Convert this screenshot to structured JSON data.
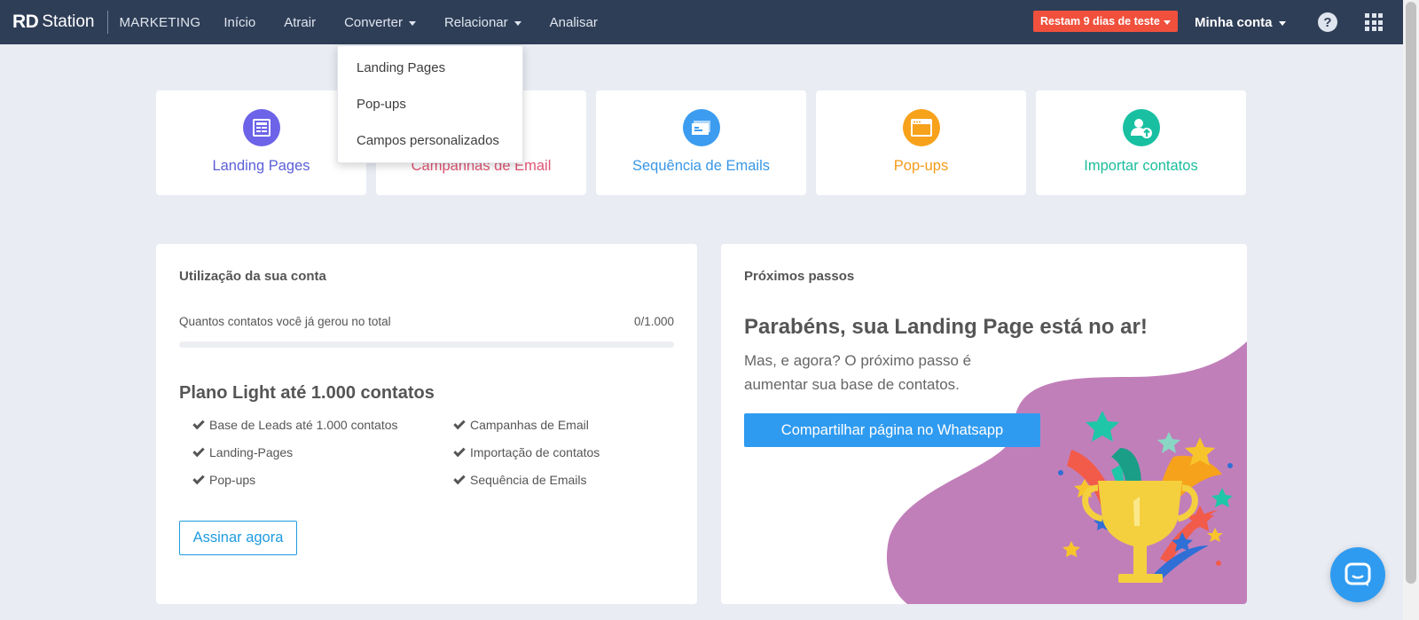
{
  "brand": {
    "logo_bold": "RD",
    "logo_rest": "Station",
    "product": "MARKETING"
  },
  "nav": {
    "items": [
      {
        "label": "Início"
      },
      {
        "label": "Atrair"
      },
      {
        "label": "Converter",
        "has_caret": true
      },
      {
        "label": "Relacionar",
        "has_caret": true
      },
      {
        "label": "Analisar"
      }
    ]
  },
  "header": {
    "trial_label": "Restam 9 dias de teste",
    "account_label": "Minha conta",
    "help_glyph": "?",
    "help_icon": "question-circle-icon",
    "apps_icon": "grid-apps-icon"
  },
  "dropdown": {
    "items": [
      "Landing Pages",
      "Pop-ups",
      "Campos personalizados"
    ]
  },
  "shortcuts": [
    {
      "label": "Landing Pages",
      "color": "#6c63e8",
      "text_color": "#5b5fd6",
      "icon": "landing-page-icon"
    },
    {
      "label": "Campanhas de Email",
      "color": "#e84a6f",
      "text_color": "#e05574",
      "icon": "email-icon"
    },
    {
      "label": "Sequência de Emails",
      "color": "#3b9cf0",
      "text_color": "#3897e6",
      "icon": "email-sequence-icon"
    },
    {
      "label": "Pop-ups",
      "color": "#f7a21b",
      "text_color": "#f39b1a",
      "icon": "popup-window-icon"
    },
    {
      "label": "Importar contatos",
      "color": "#18c0a1",
      "text_color": "#1bbd9c",
      "icon": "import-contact-icon"
    }
  ],
  "usage": {
    "title": "Utilização da sua conta",
    "label": "Quantos contatos você já gerou no total",
    "value": "0/1.000",
    "fraction": 0,
    "plan_title": "Plano Light até 1.000 contatos",
    "features": [
      "Base de Leads até 1.000 contatos",
      "Campanhas de Email",
      "Landing-Pages",
      "Importação de contatos",
      "Pop-ups",
      "Sequência de Emails"
    ],
    "subscribe_label": "Assinar agora"
  },
  "next_steps": {
    "title": "Próximos passos",
    "headline": "Parabéns, sua Landing Page está no ar!",
    "subtext": "Mas, e agora? O próximo passo é aumentar sua base de contatos.",
    "share_label": "Compartilhar página no Whatsapp",
    "illustration_icon": "trophy-icon",
    "blob_color": "#c17fba"
  },
  "chat": {
    "icon": "chat-bubble-icon"
  }
}
